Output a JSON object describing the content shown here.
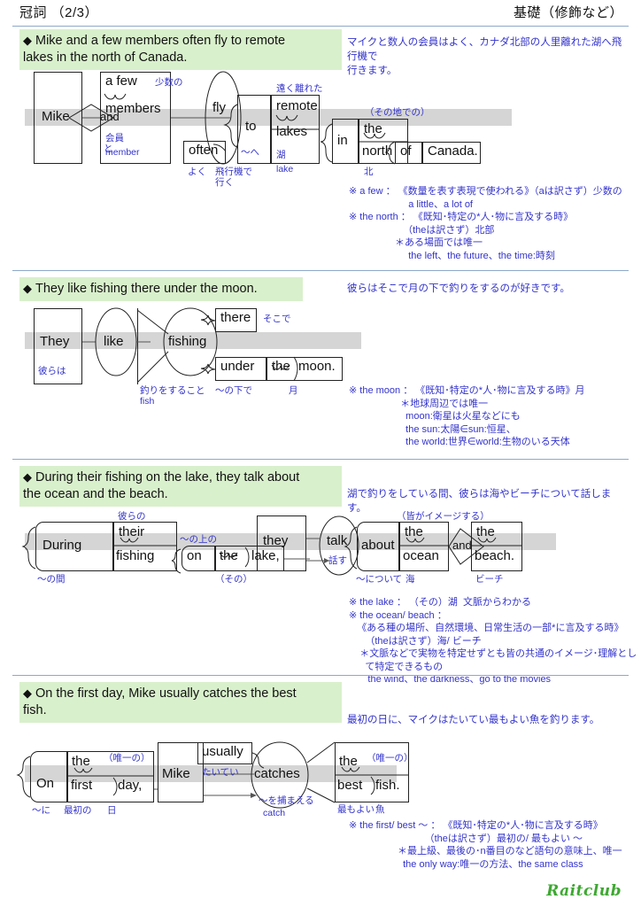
{
  "header": {
    "left_title": "冠詞 （2/3）",
    "right_title": "基礎（修飾など）"
  },
  "sections": [
    {
      "id": "s1",
      "marker": "◆",
      "english": "Mike and a few members often fly to remote\n  lakes in the north of Canada.",
      "japanese": "マイクと数人の会員はよく、カナダ北部の人里離れた湖へ飛行機で\n行きます。",
      "notes": "※ a few ： 《数量を表す表現で使われる》（aは訳さず）少数の\n                      a little、a lot of\n※ the north ： 《既知･特定の*人･物に言及する時》\n                    （theは訳さず）北部\n                 ＊ある場面では唯一\n                      the left、the future、the time:時刻",
      "diagram": {
        "words": [
          {
            "text": "Mike"
          },
          {
            "text": "and"
          },
          {
            "text": "a few"
          },
          {
            "text": "members"
          },
          {
            "text": "often"
          },
          {
            "text": "fly"
          },
          {
            "text": "to"
          },
          {
            "text": "remote"
          },
          {
            "text": "lakes"
          },
          {
            "text": "in"
          },
          {
            "text": "the"
          },
          {
            "text": "north"
          },
          {
            "text": "of"
          },
          {
            "text": "Canada."
          }
        ],
        "glosses": [
          {
            "text": "少数の"
          },
          {
            "text": "と"
          },
          {
            "text": "会員"
          },
          {
            "text": "member"
          },
          {
            "text": "よく"
          },
          {
            "text": "飛行機で\n行く"
          },
          {
            "text": "〜へ"
          },
          {
            "text": "遠く離れた"
          },
          {
            "text": "湖"
          },
          {
            "text": "lake"
          },
          {
            "text": "（その地での）"
          },
          {
            "text": "北"
          }
        ]
      }
    },
    {
      "id": "s2",
      "marker": "◆",
      "english": "They like fishing there under the moon.",
      "japanese": "彼らはそこで月の下で釣りをするのが好きです。",
      "notes": "※ the moon ： 《既知･特定の*人･物に言及する時》月\n                   ＊地球周辺では唯一\n                     moon:衛星は火星などにも\n                     the sun:太陽∈sun:恒星、\n                     the world:世界∈world:生物のいる天体",
      "diagram": {
        "words": [
          {
            "text": "They"
          },
          {
            "text": "like"
          },
          {
            "text": "fishing"
          },
          {
            "text": "there"
          },
          {
            "text": "under"
          },
          {
            "text": "the"
          },
          {
            "text": "moon."
          }
        ],
        "glosses": [
          {
            "text": "彼らは"
          },
          {
            "text": "釣りをすること"
          },
          {
            "text": "fish"
          },
          {
            "text": "そこで"
          },
          {
            "text": "〜の下で"
          },
          {
            "text": "月"
          }
        ]
      }
    },
    {
      "id": "s3",
      "marker": "◆",
      "english": "During their fishing on the lake, they talk about\n  the ocean and the beach.",
      "japanese": "湖で釣りをしている間、彼らは海やビーチについて話します。",
      "notes": "※ the lake ： （その）湖  文脈からわかる\n※ the ocean/ beach ：\n   《ある種の場所、自然環境、日常生活の一部*に言及する時》\n      （theは訳さず）海/ ビーチ\n    ＊文脈などで実物を特定せずとも皆の共通のイメージ･理解とし\n      て特定できるもの\n       the wind、the darkness、go to the movies",
      "diagram": {
        "words": [
          {
            "text": "During"
          },
          {
            "text": "their"
          },
          {
            "text": "fishing"
          },
          {
            "text": "on"
          },
          {
            "text": "the"
          },
          {
            "text": "lake,"
          },
          {
            "text": "they"
          },
          {
            "text": "talk"
          },
          {
            "text": "about"
          },
          {
            "text": "the"
          },
          {
            "text": "ocean"
          },
          {
            "text": "and"
          },
          {
            "text": "the"
          },
          {
            "text": "beach."
          }
        ],
        "glosses": [
          {
            "text": "〜の間"
          },
          {
            "text": "彼らの"
          },
          {
            "text": "〜の上の"
          },
          {
            "text": "（その）"
          },
          {
            "text": "話す"
          },
          {
            "text": "〜について"
          },
          {
            "text": "海"
          },
          {
            "text": "（皆がイメージする）"
          },
          {
            "text": "ビーチ"
          }
        ]
      }
    },
    {
      "id": "s4",
      "marker": "◆",
      "english": "On the first day, Mike usually catches the best\n  fish.",
      "japanese": "最初の日に、マイクはたいてい最もよい魚を釣ります。",
      "notes": "※ the first/ best 〜 ： 《既知･特定の*人･物に言及する時》\n                            （theは訳さず）最初の/ 最もよい 〜\n                  ＊最上級、最後の･n番目のなど語句の意味上、唯一\n                    the only way:唯一の方法、the same class",
      "diagram": {
        "words": [
          {
            "text": "On"
          },
          {
            "text": "the"
          },
          {
            "text": "first"
          },
          {
            "text": "day,"
          },
          {
            "text": "Mike"
          },
          {
            "text": "usually"
          },
          {
            "text": "catches"
          },
          {
            "text": "the"
          },
          {
            "text": "best"
          },
          {
            "text": "fish."
          }
        ],
        "glosses": [
          {
            "text": "〜に"
          },
          {
            "text": "最初の"
          },
          {
            "text": "日"
          },
          {
            "text": "（唯一の）"
          },
          {
            "text": "たいてい"
          },
          {
            "text": "〜を捕まえる"
          },
          {
            "text": "catch"
          },
          {
            "text": "（唯一の）"
          },
          {
            "text": "最もよい"
          },
          {
            "text": "魚"
          }
        ]
      }
    }
  ],
  "footer": {
    "logo": "Raitclub"
  },
  "colors": {
    "banner_green": "#d9f0cc",
    "annotation_blue": "#3333cc",
    "gray_bar": "#d5d5d5",
    "rule_blue": "#8ea8c8",
    "logo_green": "#3ea832"
  }
}
